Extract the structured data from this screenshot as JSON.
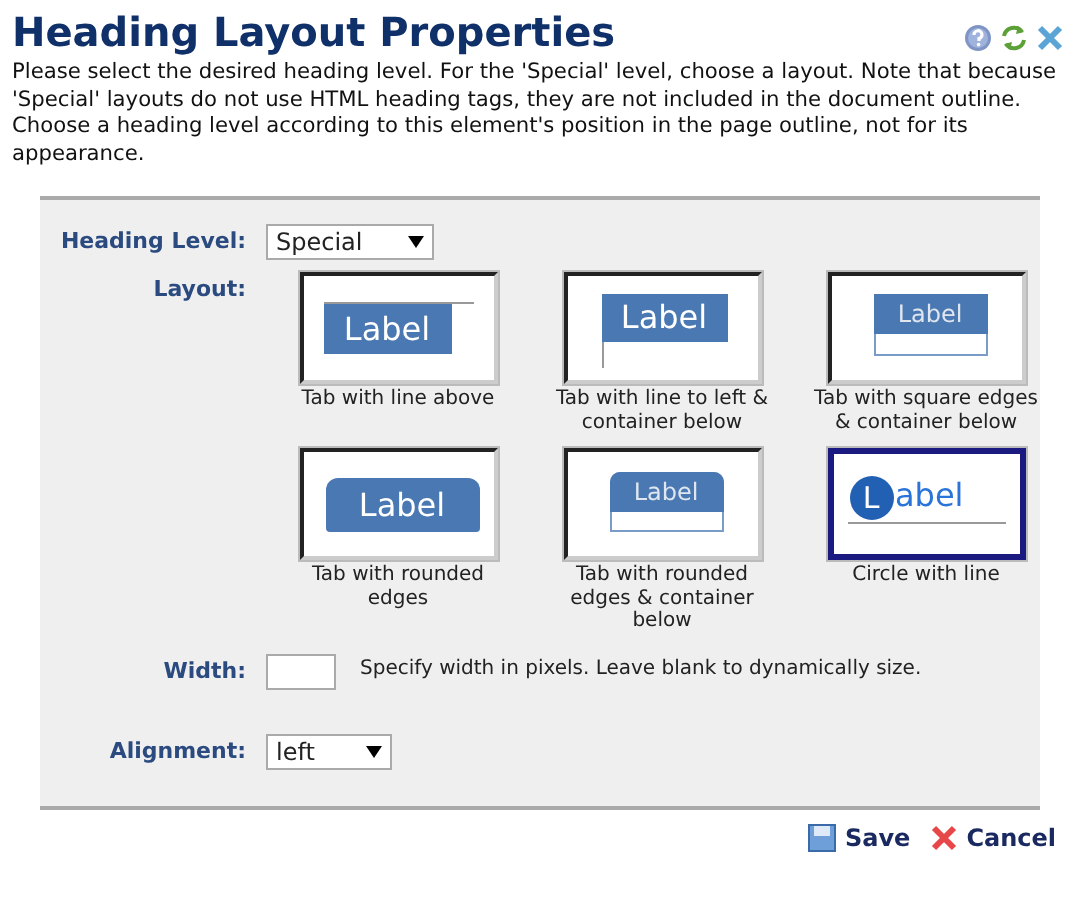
{
  "title": "Heading Layout Properties",
  "description": "Please select the desired heading level. For the 'Special' level, choose a layout. Note that because 'Special' layouts do not use HTML heading tags, they are not included in the document outline. Choose a heading level according to this element's position in the page outline, not for its appearance.",
  "heading_level": {
    "label": "Heading Level:",
    "value": "Special"
  },
  "layout": {
    "label": "Layout:",
    "options": [
      {
        "kind": "line-above",
        "preview": "Label",
        "caption": "Tab with line above",
        "selected": false
      },
      {
        "kind": "line-left",
        "preview": "Label",
        "caption": "Tab with line to left & container below",
        "selected": false
      },
      {
        "kind": "square-container",
        "preview": "Label",
        "caption": "Tab with square edges & container below",
        "selected": false
      },
      {
        "kind": "rounded",
        "preview": "Label",
        "caption": "Tab with rounded edges",
        "selected": false
      },
      {
        "kind": "rounded-container",
        "preview": "Label",
        "caption": "Tab with rounded edges & container below",
        "selected": false
      },
      {
        "kind": "circle",
        "badge": "L",
        "preview": "abel",
        "caption": "Circle with line",
        "selected": true
      }
    ]
  },
  "width": {
    "label": "Width:",
    "hint": "Specify width in pixels. Leave blank to dynamically size."
  },
  "alignment": {
    "label": "Alignment:",
    "value": "left"
  },
  "buttons": [
    {
      "kind": "save",
      "label": "Save"
    },
    {
      "kind": "cancel",
      "label": "Cancel"
    }
  ]
}
